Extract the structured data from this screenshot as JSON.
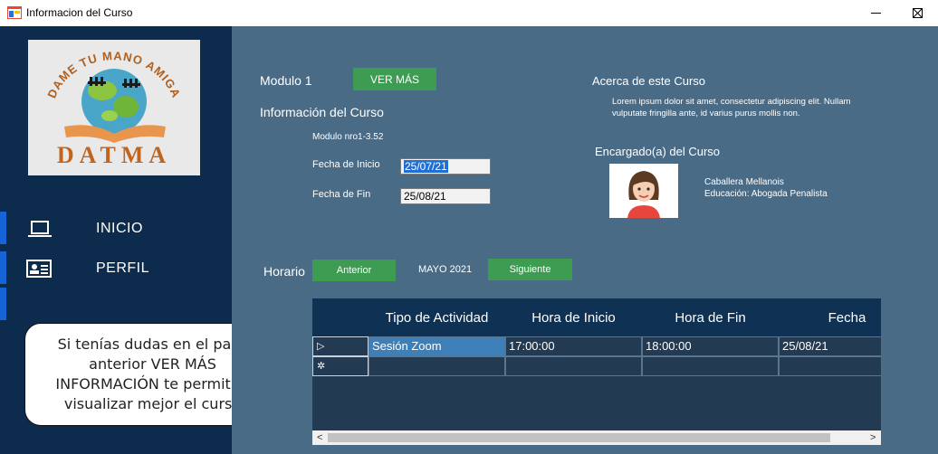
{
  "window": {
    "title": "Informacion del Curso",
    "minimize": "–",
    "maximize": "□",
    "close": "✕"
  },
  "sidebar": {
    "logo": {
      "top_text": "DAME TU MANO AMIGA",
      "bottom_text": "DATMA"
    },
    "items": [
      {
        "label": "INICIO",
        "icon": "laptop-icon"
      },
      {
        "label": "PERFIL",
        "icon": "id-card-icon"
      },
      {
        "label": "",
        "icon": ""
      }
    ],
    "tip": "Si tenías dudas en el paso anterior VER MÁS INFORMACIÓN te permitirá visualizar mejor el curso"
  },
  "module": {
    "title": "Modulo 1",
    "more_button": "VER MÁS",
    "info_heading": "Información del Curso",
    "number_label": "Modulo nro1-3.52",
    "start_label": "Fecha de Inicio",
    "start_value": "25/07/21",
    "end_label": "Fecha de Fin",
    "end_value": "25/08/21"
  },
  "about": {
    "heading": "Acerca de este Curso",
    "text_line1": "Lorem ipsum dolor sit amet, consectetur adipiscing elit. Nullam",
    "text_line2": "vulputate fringilla ante, id varius purus mollis non.",
    "manager_heading": "Encargado(a) del Curso",
    "manager_name": "Caballera Mellanois",
    "manager_education": "Educación: Abogada Penalista"
  },
  "schedule": {
    "label": "Horario",
    "prev_button": "Anterior",
    "month": "MAYO 2021",
    "next_button": "Siguiente",
    "columns": [
      "Tipo de Actividad",
      "Hora de Inicio",
      "Hora de Fin",
      "Fecha"
    ],
    "rows": [
      {
        "marker": "▷",
        "cells": [
          "Sesión Zoom",
          "17:00:00",
          "18:00:00",
          "25/08/21"
        ]
      },
      {
        "marker": "✲",
        "cells": [
          "",
          "",
          "",
          ""
        ]
      }
    ],
    "scroll_left": "<",
    "scroll_right": ">"
  },
  "colors": {
    "sidebar": "#0d2c4d",
    "main": "#4a6b86",
    "button_green": "#3d9c52",
    "nav_accent": "#1565d8",
    "grid_header": "#0f3254",
    "selected_cell": "#3f7fb8"
  }
}
